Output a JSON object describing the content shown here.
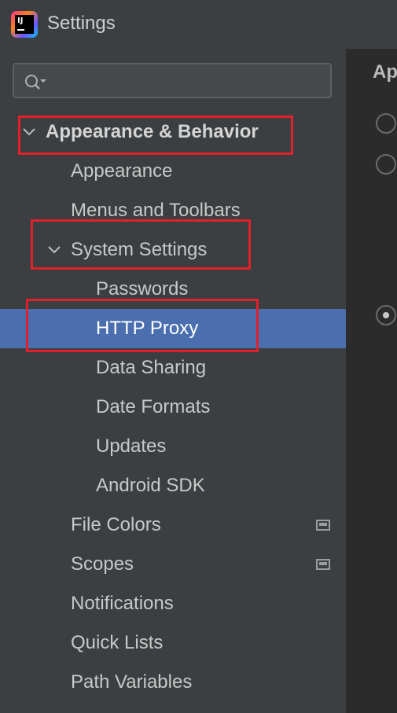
{
  "window": {
    "title": "Settings"
  },
  "search": {
    "placeholder": "",
    "value": ""
  },
  "tree": {
    "appearance_behavior": "Appearance & Behavior",
    "appearance": "Appearance",
    "menus_toolbars": "Menus and Toolbars",
    "system_settings": "System Settings",
    "passwords": "Passwords",
    "http_proxy": "HTTP Proxy",
    "data_sharing": "Data Sharing",
    "date_formats": "Date Formats",
    "updates": "Updates",
    "android_sdk": "Android SDK",
    "file_colors": "File Colors",
    "scopes": "Scopes",
    "notifications": "Notifications",
    "quick_lists": "Quick Lists",
    "path_variables": "Path Variables"
  },
  "selected_item": "HTTP Proxy",
  "right_pane": {
    "heading_fragment": "Ap"
  },
  "colors": {
    "selection": "#4b6eaf",
    "highlight_box": "#e0202a",
    "sidebar_bg": "#3c3f41",
    "content_bg": "#2b2b2b"
  },
  "icons": [
    "app-logo-icon",
    "search-icon",
    "chevron-down-icon",
    "scope-icon"
  ]
}
